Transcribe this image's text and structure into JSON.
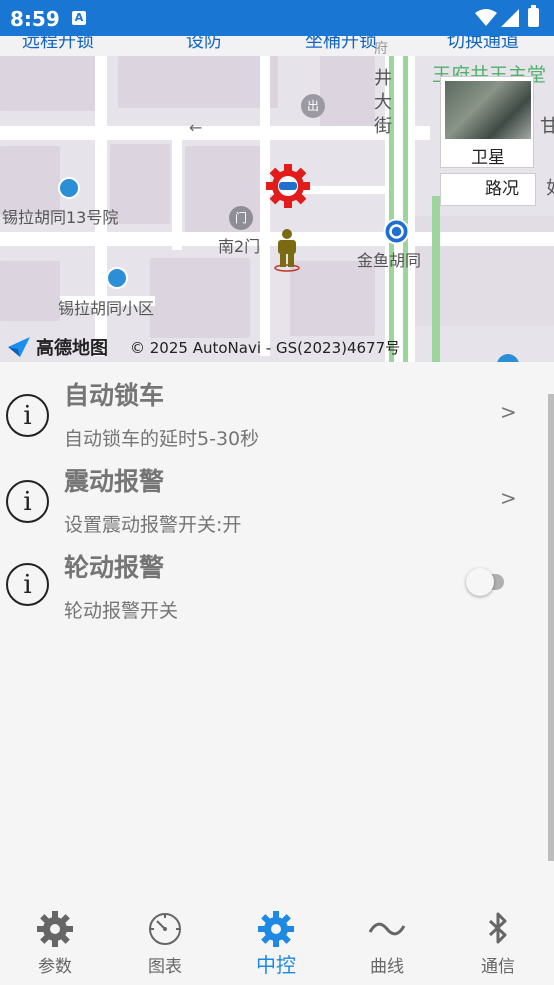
{
  "status_bar": {
    "time": "8:59",
    "notification_icon": "A"
  },
  "map": {
    "top_buttons": [
      "远程开锁",
      "设防",
      "坐桶开锁",
      "切换通道"
    ],
    "labels": {
      "poi_1": "锡拉胡同13号院",
      "poi_2": "锡拉胡同小区",
      "gate": "南2门",
      "subway": "金鱼胡同",
      "street": "街",
      "street_2": "大",
      "street_3": "井",
      "street_4": "府",
      "area": "王府井王主堂",
      "exit_glyph": "出",
      "arrow": "←",
      "right_edge_1": "甘",
      "right_edge_2": "如"
    },
    "layer_label": "卫星",
    "traffic_label": "路况",
    "logo_text": "高德地图",
    "copyright": "© 2025 AutoNavi - GS(2023)4677号"
  },
  "settings": [
    {
      "title": "自动锁车",
      "subtitle": "自动锁车的延时5-30秒",
      "control": "chevron",
      "chevron": ">"
    },
    {
      "title": "震动报警",
      "subtitle": "设置震动报警开关:开",
      "control": "chevron",
      "chevron": ">"
    },
    {
      "title": "轮动报警",
      "subtitle": "轮动报警开关",
      "control": "toggle",
      "toggle_on": false
    }
  ],
  "bottom_nav": [
    {
      "label": "参数",
      "icon": "gear-icon",
      "active": false
    },
    {
      "label": "图表",
      "icon": "dial-icon",
      "active": false
    },
    {
      "label": "中控",
      "icon": "gear-icon",
      "active": true
    },
    {
      "label": "曲线",
      "icon": "wave-icon",
      "active": false
    },
    {
      "label": "通信",
      "icon": "bluetooth-icon",
      "active": false
    }
  ],
  "colors": {
    "accent": "#1e88e5",
    "status_bar": "#1976d2",
    "text_muted": "#757575"
  }
}
